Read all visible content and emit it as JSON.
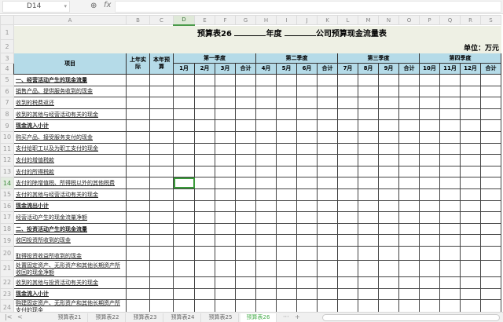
{
  "formula_bar": {
    "cell_ref": "D14",
    "fx_label": "fx",
    "formula": ""
  },
  "columns": [
    "A",
    "B",
    "C",
    "D",
    "E",
    "F",
    "G",
    "H",
    "I",
    "J",
    "K",
    "L",
    "M",
    "N",
    "O",
    "P",
    "Q",
    "R",
    "S"
  ],
  "selected_cell": {
    "col": "D",
    "row": 14
  },
  "title": {
    "prefix": "预算表26",
    "year_suffix": "年度",
    "company_suffix": "公司预算现金流量表"
  },
  "unit": "单位：万元",
  "header": {
    "item": "项目",
    "last_year": "上年实际",
    "this_year": "本年预算",
    "quarters": [
      "第一季度",
      "第二季度",
      "第三季度",
      "第四季度"
    ],
    "months": [
      "1月",
      "2月",
      "3月",
      "合计",
      "4月",
      "5月",
      "6月",
      "合计",
      "7月",
      "8月",
      "9月",
      "合计",
      "10月",
      "11月",
      "12月",
      "合计"
    ]
  },
  "rows": [
    {
      "num": 5,
      "label": "一、经营活动产生的现金流量",
      "bold": true
    },
    {
      "num": 6,
      "label": "销售产品、提供服务收到的现金",
      "bold": false
    },
    {
      "num": 7,
      "label": "收到的税费返还",
      "bold": false
    },
    {
      "num": 8,
      "label": "收到的其他与经营活动有关的现金",
      "bold": false
    },
    {
      "num": 9,
      "label": "现金流入小计",
      "bold": true
    },
    {
      "num": 10,
      "label": "购买产品、接受服务支付的现金",
      "bold": false
    },
    {
      "num": 11,
      "label": "支付给职工以及为职工支付的现金",
      "bold": false
    },
    {
      "num": 12,
      "label": "支付的增值税款",
      "bold": false
    },
    {
      "num": 13,
      "label": "支付的所得税款",
      "bold": false
    },
    {
      "num": 14,
      "label": "支付的除增值税、所得税以外的其他税费",
      "bold": false
    },
    {
      "num": 15,
      "label": "支付的其他与经营活动有关的现金",
      "bold": false
    },
    {
      "num": 16,
      "label": "现金流出小计",
      "bold": true
    },
    {
      "num": 17,
      "label": "经营活动产生的现金流量净额",
      "bold": false
    },
    {
      "num": 18,
      "label": "二、投资活动产生的现金流量",
      "bold": true
    },
    {
      "num": 19,
      "label": "收回投资所收到的现金",
      "bold": false
    },
    {
      "num": 20,
      "label": "取得投资收益所收到的现金",
      "bold": false
    },
    {
      "num": 21,
      "label": "处置固定资产、无形资产和其他长期资产所收回的现金净额",
      "bold": false
    },
    {
      "num": 22,
      "label": "收到的其他与投资活动有关的现金",
      "bold": false
    },
    {
      "num": 23,
      "label": "现金流入小计",
      "bold": true
    },
    {
      "num": 24,
      "label": "购建固定资产、无形资产和其他长期资产所支付的现金",
      "bold": false
    }
  ],
  "sheet_tabs": [
    "预算表21",
    "预算表22",
    "预算表23",
    "预算表24",
    "预算表25",
    "预算表26"
  ],
  "active_tab": "预算表26",
  "tab_more": "···",
  "tab_add": "+"
}
